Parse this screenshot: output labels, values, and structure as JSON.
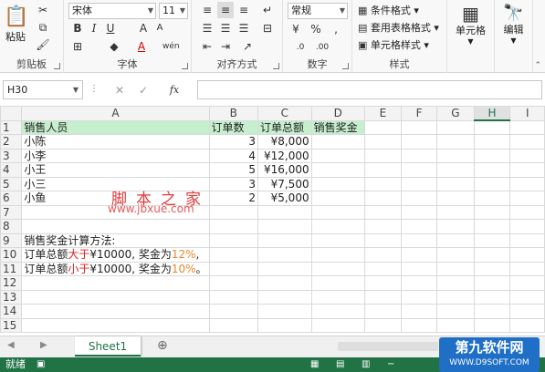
{
  "ribbon": {
    "clipboard": {
      "group_label": "剪贴板",
      "paste_label": "粘贴"
    },
    "font": {
      "group_label": "字体",
      "font_name": "宋体",
      "font_size": "11"
    },
    "alignment": {
      "group_label": "对齐方式"
    },
    "number": {
      "group_label": "数字",
      "format": "常规"
    },
    "styles": {
      "group_label": "样式",
      "conditional_format": "条件格式",
      "table_format": "套用表格格式",
      "cell_styles": "单元格样式"
    },
    "cells": {
      "label": "单元格"
    },
    "editing": {
      "label": "编辑"
    }
  },
  "formula_bar": {
    "name_box": "H30",
    "fx": "fx",
    "formula": ""
  },
  "columns": [
    "A",
    "B",
    "C",
    "D",
    "E",
    "F",
    "G",
    "H",
    "I"
  ],
  "rows": [
    [
      "销售人员",
      "订单数",
      "订单总额",
      "销售奖金",
      "",
      "",
      "",
      "",
      ""
    ],
    [
      "小陈",
      "3",
      "¥8,000",
      "",
      "",
      "",
      "",
      "",
      ""
    ],
    [
      "小李",
      "4",
      "¥12,000",
      "",
      "",
      "",
      "",
      "",
      ""
    ],
    [
      "小王",
      "5",
      "¥16,000",
      "",
      "",
      "",
      "",
      "",
      ""
    ],
    [
      "小三",
      "3",
      "¥7,500",
      "",
      "",
      "",
      "",
      "",
      ""
    ],
    [
      "小鱼",
      "2",
      "¥5,000",
      "",
      "",
      "",
      "",
      "",
      ""
    ],
    [
      "",
      "",
      "",
      "",
      "",
      "",
      "",
      "",
      ""
    ],
    [
      "",
      "",
      "",
      "",
      "",
      "",
      "",
      "",
      ""
    ],
    [
      "销售奖金计算方法:",
      "",
      "",
      "",
      "",
      "",
      "",
      "",
      ""
    ],
    [
      "",
      "",
      "",
      "",
      "",
      "",
      "",
      "",
      ""
    ],
    [
      "",
      "",
      "",
      "",
      "",
      "",
      "",
      "",
      ""
    ],
    [
      "",
      "",
      "",
      "",
      "",
      "",
      "",
      "",
      ""
    ],
    [
      "",
      "",
      "",
      "",
      "",
      "",
      "",
      "",
      ""
    ],
    [
      "",
      "",
      "",
      "",
      "",
      "",
      "",
      "",
      ""
    ],
    [
      "",
      "",
      "",
      "",
      "",
      "",
      "",
      "",
      ""
    ]
  ],
  "rule1": {
    "a": "订单总额",
    "b": "大于",
    "c": "¥10000, 奖金为",
    "d": "12%",
    "e": ","
  },
  "rule2": {
    "a": "订单总额",
    "b": "小于",
    "c": "¥10000, 奖金为",
    "d": "10%",
    "e": "。"
  },
  "watermark": {
    "title": "脚本之家",
    "url": "www.jbxue.com"
  },
  "sheets": {
    "active": "Sheet1"
  },
  "status": {
    "ready": "就绪"
  },
  "logo": {
    "line1": "第九软件网",
    "line2": "WWW.D9SOFT.COM"
  },
  "colors": {
    "header_fill": "#c6efce",
    "accent": "#217346",
    "red": "#e02020",
    "orange": "#e8872a"
  }
}
